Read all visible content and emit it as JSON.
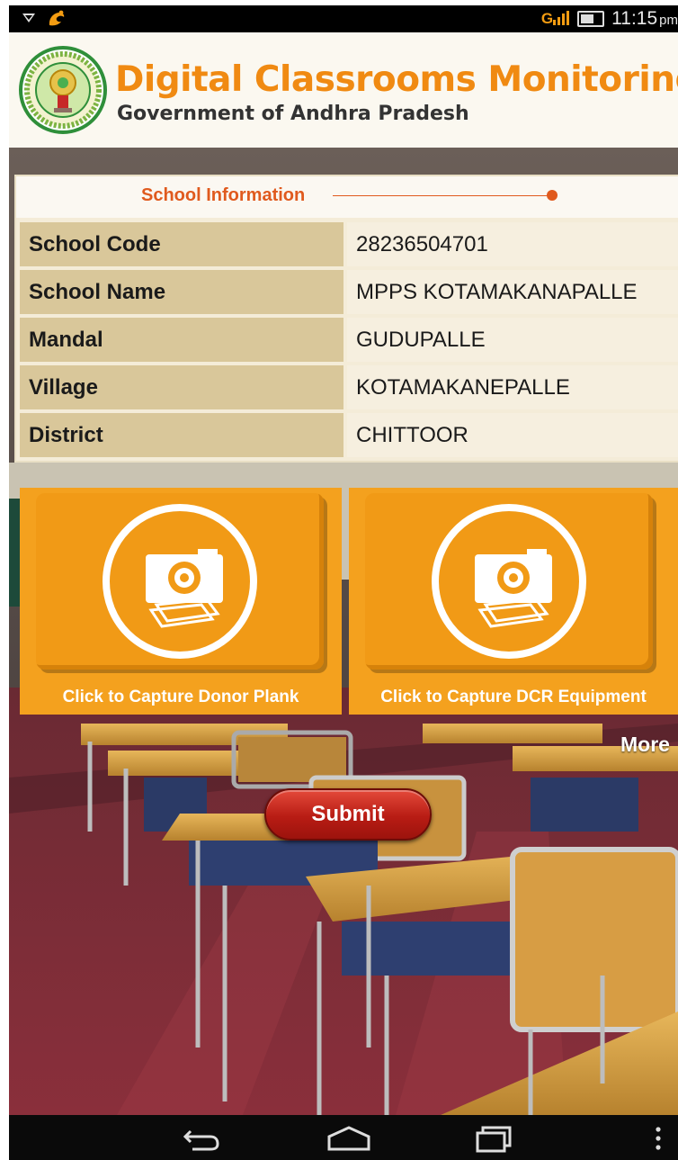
{
  "status_bar": {
    "network": "G",
    "time": "11:15",
    "ampm": "pm"
  },
  "header": {
    "title": "Digital Classrooms Monitoring",
    "subtitle": "Government of Andhra Pradesh"
  },
  "school_info": {
    "heading": "School Information",
    "rows": [
      {
        "label": "School Code",
        "value": "28236504701"
      },
      {
        "label": "School Name",
        "value": "MPPS KOTAMAKANAPALLE"
      },
      {
        "label": "Mandal",
        "value": "GUDUPALLE"
      },
      {
        "label": "Village",
        "value": "KOTAMAKANEPALLE"
      },
      {
        "label": "District",
        "value": "CHITTOOR"
      }
    ]
  },
  "capture": {
    "donor_plank": "Click to Capture Donor Plank",
    "dcr_equipment": "Click to Capture DCR Equipment"
  },
  "more_label": "More",
  "submit_label": "Submit",
  "icons": [
    "antenna-icon",
    "uc-browser-icon",
    "signal-icon",
    "battery-icon",
    "camera-icon",
    "back-icon",
    "home-icon",
    "recents-icon",
    "overflow-menu-icon"
  ]
}
